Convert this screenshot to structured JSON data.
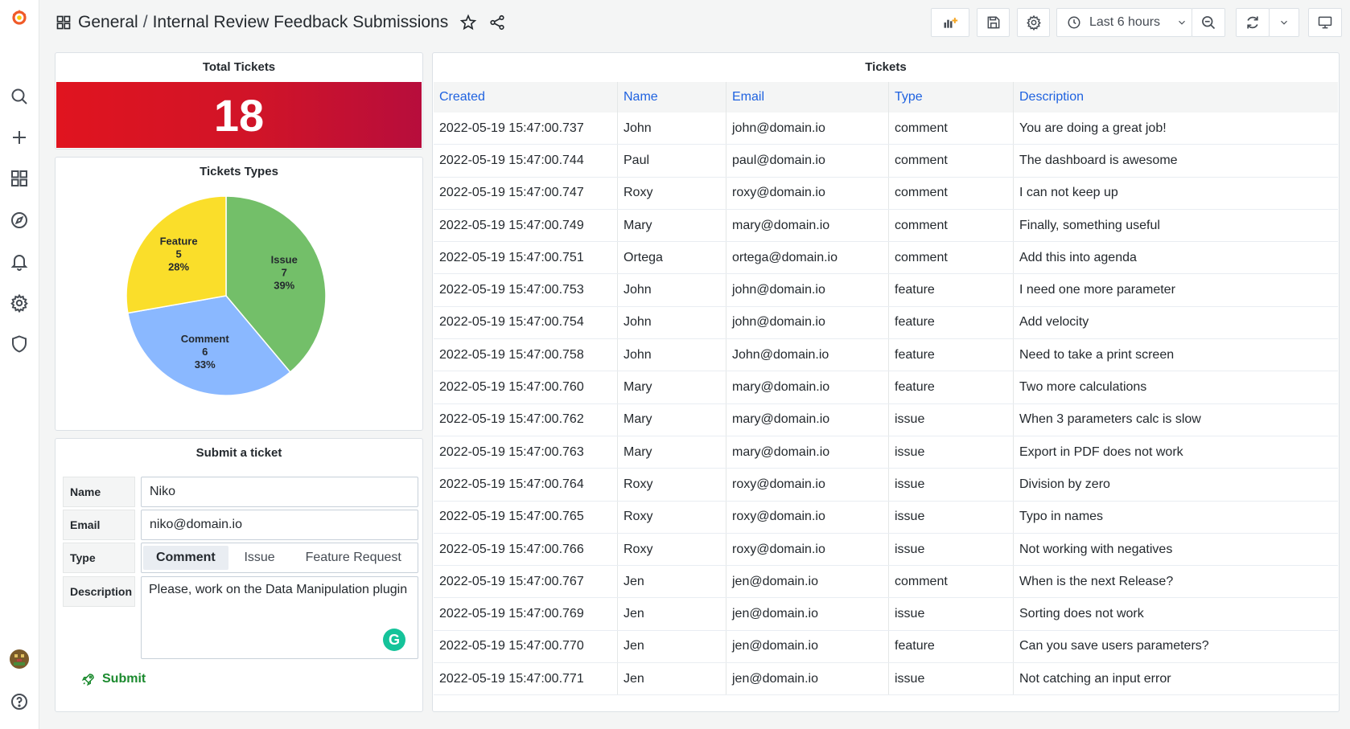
{
  "header": {
    "folder": "General",
    "title": "Internal Review Feedback Submissions",
    "time_range": "Last 6 hours"
  },
  "total_tickets": {
    "title": "Total Tickets",
    "value": "18",
    "color": "#d01428"
  },
  "pie": {
    "title": "Tickets Types",
    "slices": [
      {
        "label": "Issue",
        "value": 7,
        "percent": "39%",
        "color": "#73bf69"
      },
      {
        "label": "Comment",
        "value": 6,
        "percent": "33%",
        "color": "#8ab8ff"
      },
      {
        "label": "Feature",
        "value": 5,
        "percent": "28%",
        "color": "#fade2a"
      }
    ]
  },
  "form": {
    "title": "Submit a ticket",
    "name_label": "Name",
    "name_value": "Niko",
    "email_label": "Email",
    "email_value": "niko@domain.io",
    "type_label": "Type",
    "type_options": [
      "Comment",
      "Issue",
      "Feature Request"
    ],
    "type_selected": "Comment",
    "description_label": "Description",
    "description_value": "Please, work on the Data Manipulation plugin",
    "submit_label": "Submit"
  },
  "table": {
    "title": "Tickets",
    "columns": [
      "Created",
      "Name",
      "Email",
      "Type",
      "Description"
    ],
    "rows": [
      [
        "2022-05-19 15:47:00.737",
        "John",
        "john@domain.io",
        "comment",
        "You are doing a great job!"
      ],
      [
        "2022-05-19 15:47:00.744",
        "Paul",
        "paul@domain.io",
        "comment",
        "The dashboard is awesome"
      ],
      [
        "2022-05-19 15:47:00.747",
        "Roxy",
        "roxy@domain.io",
        "comment",
        "I can not keep up"
      ],
      [
        "2022-05-19 15:47:00.749",
        "Mary",
        "mary@domain.io",
        "comment",
        "Finally, something useful"
      ],
      [
        "2022-05-19 15:47:00.751",
        "Ortega",
        "ortega@domain.io",
        "comment",
        "Add this into agenda"
      ],
      [
        "2022-05-19 15:47:00.753",
        "John",
        "john@domain.io",
        "feature",
        "I need one more parameter"
      ],
      [
        "2022-05-19 15:47:00.754",
        "John",
        "john@domain.io",
        "feature",
        "Add velocity"
      ],
      [
        "2022-05-19 15:47:00.758",
        "John",
        "John@domain.io",
        "feature",
        "Need to take a print screen"
      ],
      [
        "2022-05-19 15:47:00.760",
        "Mary",
        "mary@domain.io",
        "feature",
        "Two more calculations"
      ],
      [
        "2022-05-19 15:47:00.762",
        "Mary",
        "mary@domain.io",
        "issue",
        "When 3 parameters calc is slow"
      ],
      [
        "2022-05-19 15:47:00.763",
        "Mary",
        "mary@domain.io",
        "issue",
        "Export in PDF does not work"
      ],
      [
        "2022-05-19 15:47:00.764",
        "Roxy",
        "roxy@domain.io",
        "issue",
        "Division by zero"
      ],
      [
        "2022-05-19 15:47:00.765",
        "Roxy",
        "roxy@domain.io",
        "issue",
        "Typo in names"
      ],
      [
        "2022-05-19 15:47:00.766",
        "Roxy",
        "roxy@domain.io",
        "issue",
        "Not working with negatives"
      ],
      [
        "2022-05-19 15:47:00.767",
        "Jen",
        "jen@domain.io",
        "comment",
        "When is the next Release?"
      ],
      [
        "2022-05-19 15:47:00.769",
        "Jen",
        "jen@domain.io",
        "issue",
        "Sorting does not work"
      ],
      [
        "2022-05-19 15:47:00.770",
        "Jen",
        "jen@domain.io",
        "feature",
        "Can you save users parameters?"
      ],
      [
        "2022-05-19 15:47:00.771",
        "Jen",
        "jen@domain.io",
        "issue",
        "Not catching an input error"
      ]
    ]
  },
  "sidebar": {
    "items": [
      "grafana-logo-icon",
      "search-icon",
      "plus-icon",
      "dashboards-icon",
      "explore-icon",
      "alerting-icon",
      "configuration-icon",
      "server-admin-icon",
      "user-avatar",
      "help-icon"
    ]
  }
}
